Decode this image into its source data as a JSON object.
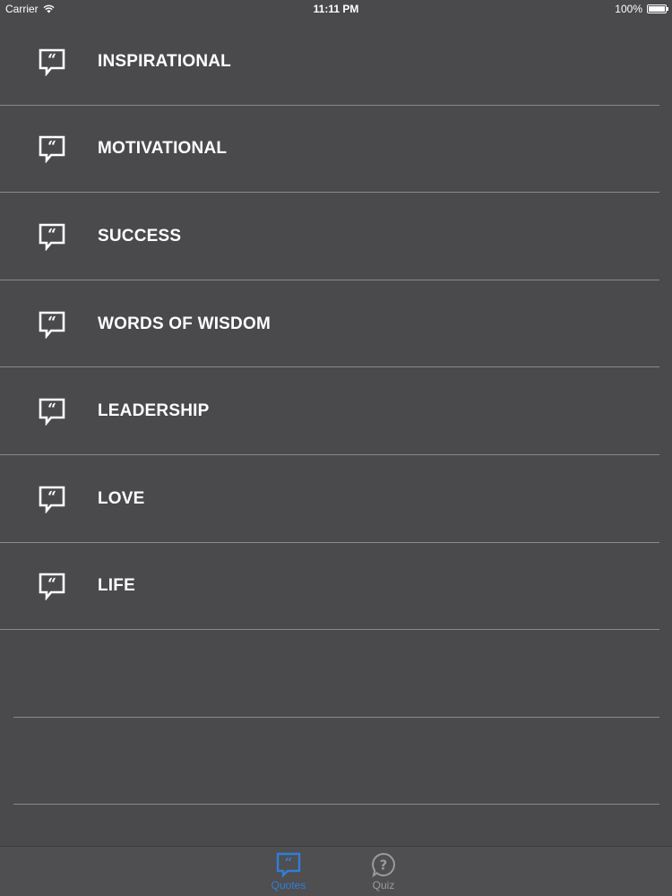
{
  "status_bar": {
    "carrier": "Carrier",
    "time": "11:11 PM",
    "battery": "100%",
    "battery_level": 1.0
  },
  "list": {
    "items": [
      {
        "label": "INSPIRATIONAL",
        "icon": "quote-bubble-icon"
      },
      {
        "label": "MOTIVATIONAL",
        "icon": "quote-bubble-icon"
      },
      {
        "label": "SUCCESS",
        "icon": "quote-bubble-icon"
      },
      {
        "label": "WORDS OF WISDOM",
        "icon": "quote-bubble-icon"
      },
      {
        "label": "LEADERSHIP",
        "icon": "quote-bubble-icon"
      },
      {
        "label": "LOVE",
        "icon": "quote-bubble-icon"
      },
      {
        "label": "LIFE",
        "icon": "quote-bubble-icon"
      }
    ]
  },
  "tab_bar": {
    "tabs": [
      {
        "label": "Quotes",
        "icon": "quotes-tab-icon",
        "selected": true
      },
      {
        "label": "Quiz",
        "icon": "question-circle-icon",
        "selected": false
      }
    ]
  },
  "colors": {
    "background": "#4a494c",
    "separator": "#8a898c",
    "accent": "#2f7fd6",
    "tab_inactive": "#9a999c"
  }
}
